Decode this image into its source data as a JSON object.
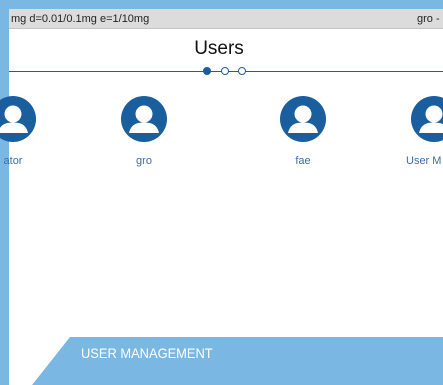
{
  "status_bar": {
    "left_text": "mg  d=0.01/0.1mg  e=1/10mg",
    "right_text": "gro  -"
  },
  "page": {
    "title": "Users",
    "pager": {
      "total": 3,
      "active": 1
    }
  },
  "users": [
    {
      "label": "ator"
    },
    {
      "label": "gro"
    },
    {
      "label": "fae"
    },
    {
      "label": "User M"
    }
  ],
  "banner": {
    "label": "USER MANAGEMENT"
  },
  "colors": {
    "accent_dark": "#1a5e9e",
    "accent_light": "#7ab8e3",
    "label_blue": "#3a6fa6",
    "status_bg": "#dcdcdc"
  },
  "icons": {
    "user_avatar": "user-avatar-icon"
  }
}
